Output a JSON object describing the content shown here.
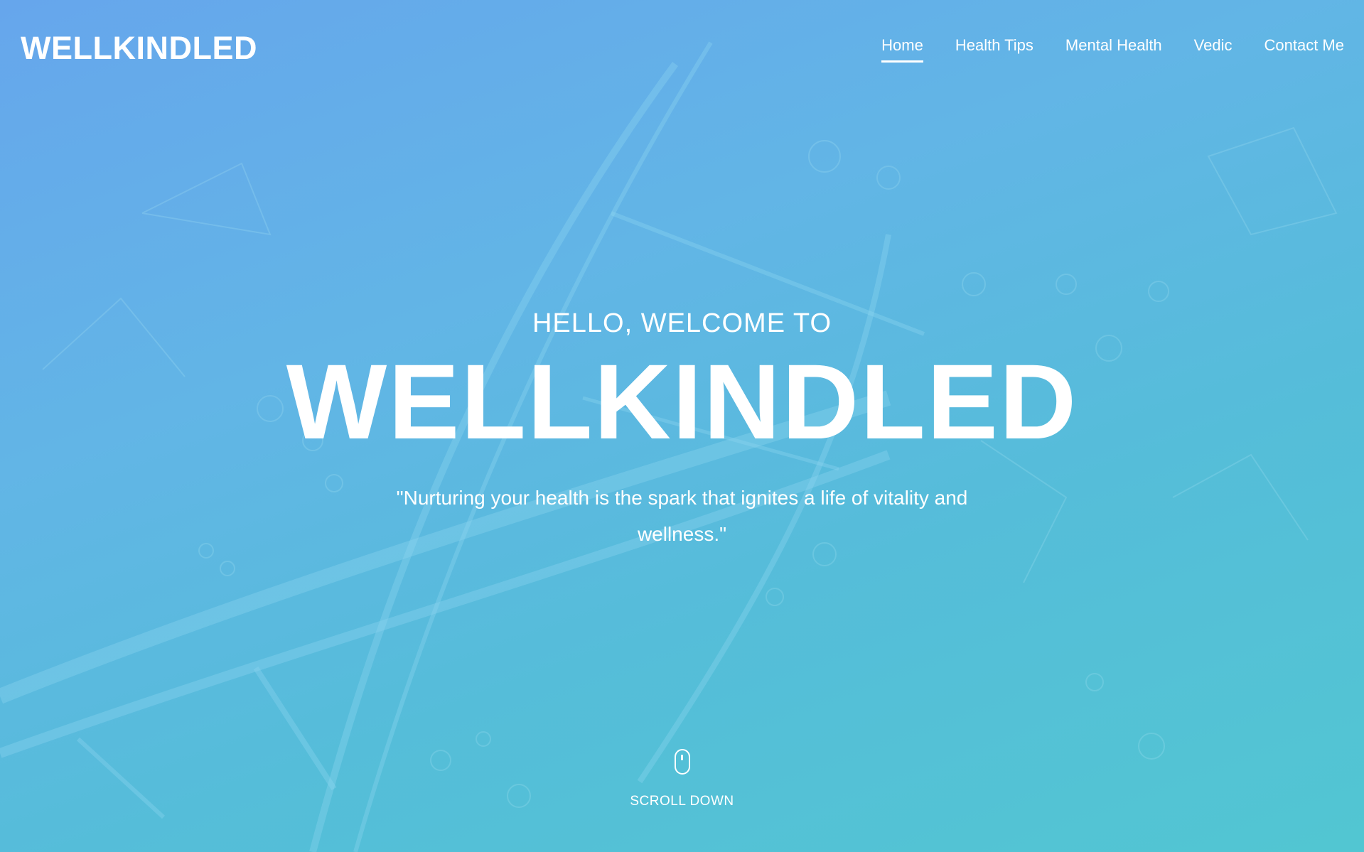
{
  "brand": {
    "logo_text": "WELLKINDLED"
  },
  "nav": {
    "items": [
      {
        "label": "Home",
        "active": true
      },
      {
        "label": "Health Tips",
        "active": false
      },
      {
        "label": "Mental Health",
        "active": false
      },
      {
        "label": "Vedic",
        "active": false
      },
      {
        "label": "Contact Me",
        "active": false
      }
    ]
  },
  "hero": {
    "greeting": "HELLO, WELCOME TO",
    "title": "WELLKINDLED",
    "quote": "\"Nurturing your health is the spark that ignites a life of vitality and wellness.\""
  },
  "scroll": {
    "icon": "mouse-icon",
    "label": "SCROLL DOWN"
  },
  "colors": {
    "gradient_top": "#66a6ec",
    "gradient_bottom": "#52c6d2",
    "text": "#ffffff"
  }
}
